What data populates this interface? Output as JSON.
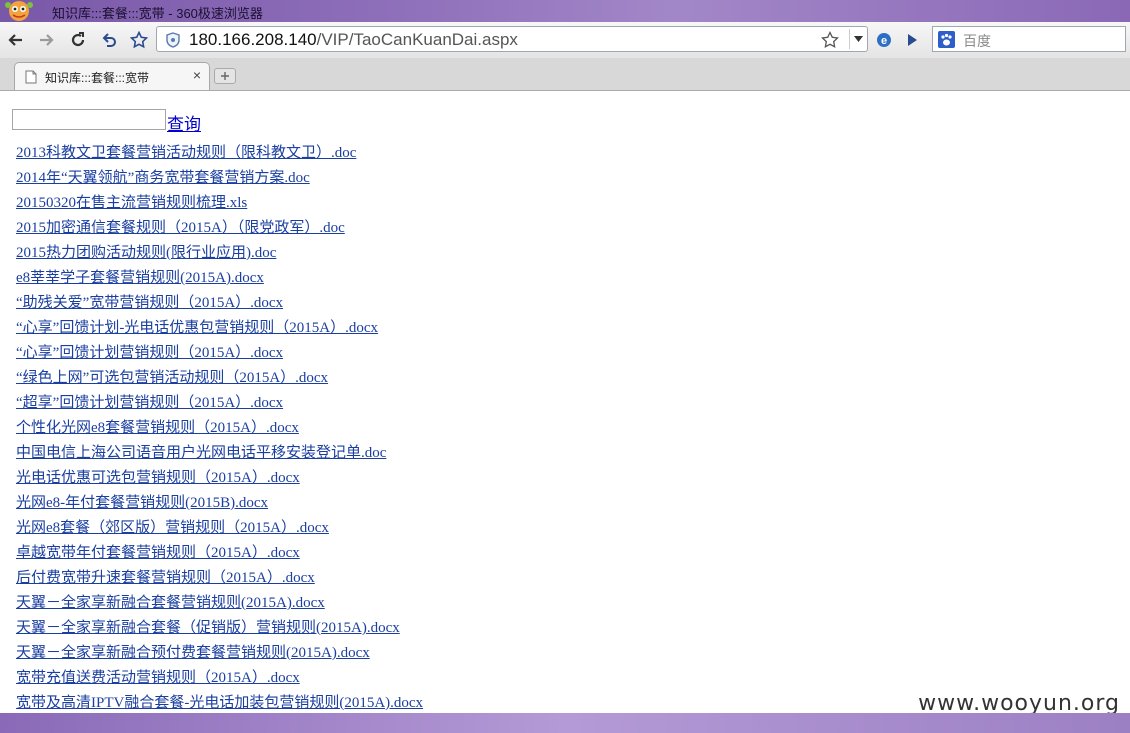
{
  "window": {
    "title": "知识库:::套餐:::宽带 - 360极速浏览器"
  },
  "address": {
    "host": "180.166.208.140",
    "path": "/VIP/TaoCanKuanDai.aspx"
  },
  "search": {
    "placeholder": "百度"
  },
  "tab": {
    "title": "知识库:::套餐:::宽带",
    "close": "×"
  },
  "query": {
    "link_label": "查询",
    "input_value": ""
  },
  "files": [
    "2013科教文卫套餐营销活动规则（限科教文卫）.doc",
    "2014年“天翼领航”商务宽带套餐营销方案.doc",
    "20150320在售主流营销规则梳理.xls",
    "2015加密通信套餐规则（2015A）（限党政军）.doc",
    "2015热力团购活动规则(限行业应用).doc",
    "e8莘莘学子套餐营销规则(2015A).docx",
    "“助残关爱”宽带营销规则（2015A）.docx",
    "“心享”回馈计划-光电话优惠包营销规则（2015A）.docx",
    "“心享”回馈计划营销规则（2015A）.docx",
    "“绿色上网”可选包营销活动规则（2015A）.docx",
    "“超享”回馈计划营销规则（2015A）.docx",
    "个性化光网e8套餐营销规则（2015A）.docx",
    "中国电信上海公司语音用户光网电话平移安装登记单.doc",
    "光电话优惠可选包营销规则（2015A）.docx",
    "光网e8-年付套餐营销规则(2015B).docx",
    "光网e8套餐（郊区版）营销规则（2015A）.docx",
    "卓越宽带年付套餐营销规则（2015A）.docx",
    "后付费宽带升速套餐营销规则（2015A）.docx",
    "天翼－全家享新融合套餐营销规则(2015A).docx",
    "天翼－全家享新融合套餐（促销版）营销规则(2015A).docx",
    "天翼－全家享新融合预付费套餐营销规则(2015A).docx",
    "宽带充值送费活动营销规则（2015A）.docx",
    "宽带及高清IPTV融合套餐-光电话加装包营销规则(2015A).docx"
  ],
  "watermark": "www.wooyun.org",
  "colors": {
    "link": "#1a3fa0",
    "titlebar": "#8a68b6"
  }
}
